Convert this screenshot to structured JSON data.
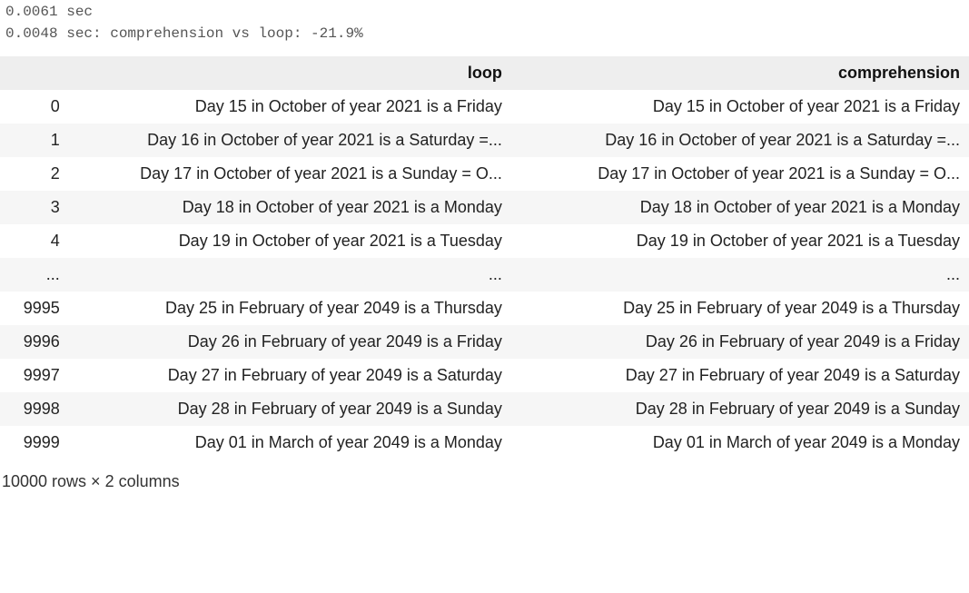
{
  "output_lines": [
    "0.0061 sec",
    "0.0048 sec: comprehension vs loop: -21.9%"
  ],
  "table": {
    "columns": [
      "loop",
      "comprehension"
    ],
    "rows": [
      {
        "index": "0",
        "loop": "Day 15 in October of year 2021 is a Friday",
        "comprehension": "Day 15 in October of year 2021 is a Friday"
      },
      {
        "index": "1",
        "loop": "Day 16 in October of year 2021 is a Saturday =...",
        "comprehension": "Day 16 in October of year 2021 is a Saturday =..."
      },
      {
        "index": "2",
        "loop": "Day 17 in October of year 2021 is a Sunday = O...",
        "comprehension": "Day 17 in October of year 2021 is a Sunday = O..."
      },
      {
        "index": "3",
        "loop": "Day 18 in October of year 2021 is a Monday",
        "comprehension": "Day 18 in October of year 2021 is a Monday"
      },
      {
        "index": "4",
        "loop": "Day 19 in October of year 2021 is a Tuesday",
        "comprehension": "Day 19 in October of year 2021 is a Tuesday"
      },
      {
        "index": "...",
        "loop": "...",
        "comprehension": "..."
      },
      {
        "index": "9995",
        "loop": "Day 25 in February of year 2049 is a Thursday",
        "comprehension": "Day 25 in February of year 2049 is a Thursday"
      },
      {
        "index": "9996",
        "loop": "Day 26 in February of year 2049 is a Friday",
        "comprehension": "Day 26 in February of year 2049 is a Friday"
      },
      {
        "index": "9997",
        "loop": "Day 27 in February of year 2049 is a Saturday",
        "comprehension": "Day 27 in February of year 2049 is a Saturday"
      },
      {
        "index": "9998",
        "loop": "Day 28 in February of year 2049 is a Sunday",
        "comprehension": "Day 28 in February of year 2049 is a Sunday"
      },
      {
        "index": "9999",
        "loop": "Day 01 in March of year 2049 is a Monday",
        "comprehension": "Day 01 in March of year 2049 is a Monday"
      }
    ],
    "dimensions": "10000 rows × 2 columns"
  }
}
